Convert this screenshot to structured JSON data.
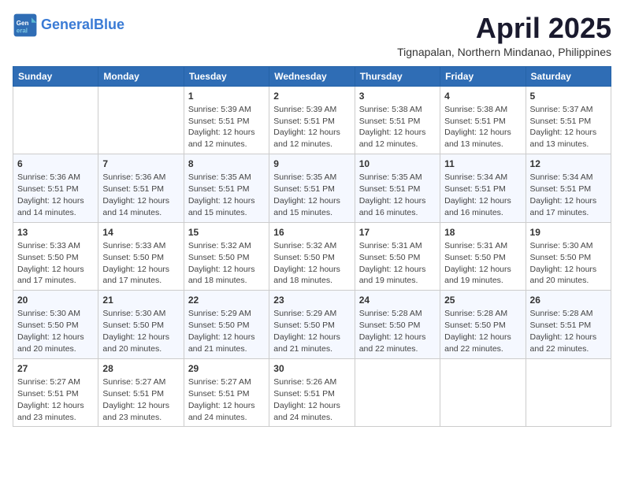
{
  "header": {
    "logo_general": "General",
    "logo_blue": "Blue",
    "month": "April 2025",
    "location": "Tignapalan, Northern Mindanao, Philippines"
  },
  "weekdays": [
    "Sunday",
    "Monday",
    "Tuesday",
    "Wednesday",
    "Thursday",
    "Friday",
    "Saturday"
  ],
  "weeks": [
    [
      {
        "day": null
      },
      {
        "day": null
      },
      {
        "day": "1",
        "sunrise": "5:39 AM",
        "sunset": "5:51 PM",
        "daylight": "12 hours and 12 minutes."
      },
      {
        "day": "2",
        "sunrise": "5:39 AM",
        "sunset": "5:51 PM",
        "daylight": "12 hours and 12 minutes."
      },
      {
        "day": "3",
        "sunrise": "5:38 AM",
        "sunset": "5:51 PM",
        "daylight": "12 hours and 12 minutes."
      },
      {
        "day": "4",
        "sunrise": "5:38 AM",
        "sunset": "5:51 PM",
        "daylight": "12 hours and 13 minutes."
      },
      {
        "day": "5",
        "sunrise": "5:37 AM",
        "sunset": "5:51 PM",
        "daylight": "12 hours and 13 minutes."
      }
    ],
    [
      {
        "day": "6",
        "sunrise": "5:36 AM",
        "sunset": "5:51 PM",
        "daylight": "12 hours and 14 minutes."
      },
      {
        "day": "7",
        "sunrise": "5:36 AM",
        "sunset": "5:51 PM",
        "daylight": "12 hours and 14 minutes."
      },
      {
        "day": "8",
        "sunrise": "5:35 AM",
        "sunset": "5:51 PM",
        "daylight": "12 hours and 15 minutes."
      },
      {
        "day": "9",
        "sunrise": "5:35 AM",
        "sunset": "5:51 PM",
        "daylight": "12 hours and 15 minutes."
      },
      {
        "day": "10",
        "sunrise": "5:35 AM",
        "sunset": "5:51 PM",
        "daylight": "12 hours and 16 minutes."
      },
      {
        "day": "11",
        "sunrise": "5:34 AM",
        "sunset": "5:51 PM",
        "daylight": "12 hours and 16 minutes."
      },
      {
        "day": "12",
        "sunrise": "5:34 AM",
        "sunset": "5:51 PM",
        "daylight": "12 hours and 17 minutes."
      }
    ],
    [
      {
        "day": "13",
        "sunrise": "5:33 AM",
        "sunset": "5:50 PM",
        "daylight": "12 hours and 17 minutes."
      },
      {
        "day": "14",
        "sunrise": "5:33 AM",
        "sunset": "5:50 PM",
        "daylight": "12 hours and 17 minutes."
      },
      {
        "day": "15",
        "sunrise": "5:32 AM",
        "sunset": "5:50 PM",
        "daylight": "12 hours and 18 minutes."
      },
      {
        "day": "16",
        "sunrise": "5:32 AM",
        "sunset": "5:50 PM",
        "daylight": "12 hours and 18 minutes."
      },
      {
        "day": "17",
        "sunrise": "5:31 AM",
        "sunset": "5:50 PM",
        "daylight": "12 hours and 19 minutes."
      },
      {
        "day": "18",
        "sunrise": "5:31 AM",
        "sunset": "5:50 PM",
        "daylight": "12 hours and 19 minutes."
      },
      {
        "day": "19",
        "sunrise": "5:30 AM",
        "sunset": "5:50 PM",
        "daylight": "12 hours and 20 minutes."
      }
    ],
    [
      {
        "day": "20",
        "sunrise": "5:30 AM",
        "sunset": "5:50 PM",
        "daylight": "12 hours and 20 minutes."
      },
      {
        "day": "21",
        "sunrise": "5:30 AM",
        "sunset": "5:50 PM",
        "daylight": "12 hours and 20 minutes."
      },
      {
        "day": "22",
        "sunrise": "5:29 AM",
        "sunset": "5:50 PM",
        "daylight": "12 hours and 21 minutes."
      },
      {
        "day": "23",
        "sunrise": "5:29 AM",
        "sunset": "5:50 PM",
        "daylight": "12 hours and 21 minutes."
      },
      {
        "day": "24",
        "sunrise": "5:28 AM",
        "sunset": "5:50 PM",
        "daylight": "12 hours and 22 minutes."
      },
      {
        "day": "25",
        "sunrise": "5:28 AM",
        "sunset": "5:50 PM",
        "daylight": "12 hours and 22 minutes."
      },
      {
        "day": "26",
        "sunrise": "5:28 AM",
        "sunset": "5:51 PM",
        "daylight": "12 hours and 22 minutes."
      }
    ],
    [
      {
        "day": "27",
        "sunrise": "5:27 AM",
        "sunset": "5:51 PM",
        "daylight": "12 hours and 23 minutes."
      },
      {
        "day": "28",
        "sunrise": "5:27 AM",
        "sunset": "5:51 PM",
        "daylight": "12 hours and 23 minutes."
      },
      {
        "day": "29",
        "sunrise": "5:27 AM",
        "sunset": "5:51 PM",
        "daylight": "12 hours and 24 minutes."
      },
      {
        "day": "30",
        "sunrise": "5:26 AM",
        "sunset": "5:51 PM",
        "daylight": "12 hours and 24 minutes."
      },
      {
        "day": null
      },
      {
        "day": null
      },
      {
        "day": null
      }
    ]
  ]
}
